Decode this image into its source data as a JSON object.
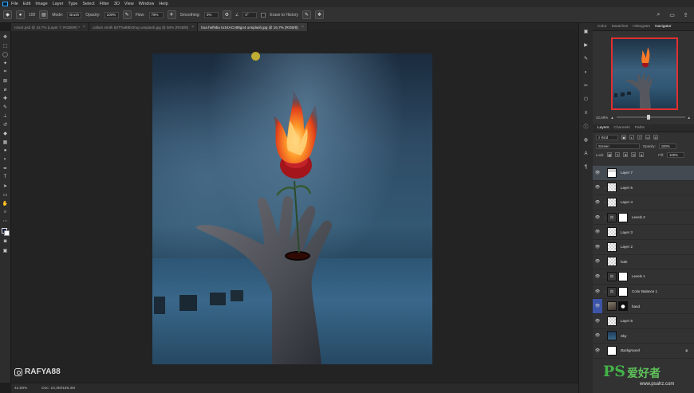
{
  "menu": [
    "File",
    "Edit",
    "Image",
    "Layer",
    "Type",
    "Select",
    "Filter",
    "3D",
    "View",
    "Window",
    "Help"
  ],
  "options": {
    "brush_size": "100",
    "mode_label": "Mode:",
    "mode_value": "Brush",
    "opacity_label": "Opacity:",
    "opacity_value": "100%",
    "flow_label": "Flow:",
    "flow_value": "79%",
    "smoothing_label": "Smoothing:",
    "smoothing_value": "0%",
    "angle_value": "0°",
    "erase_to_history": "Erase to History"
  },
  "tabs": [
    {
      "label": "rose2.psd @ 42,7% (Layer 7, RGB/8#) *",
      "active": false
    },
    {
      "label": "callum smith 8dTTwB8bOmg unsplash.jpg @ 50% (RGB/8)",
      "active": false
    },
    {
      "label": "boa hefNbu to1KACnt8tgo4 unsplash.jpg @ 16,7% (RGB/8)",
      "active": true
    }
  ],
  "status": {
    "zoom": "42,69%",
    "doc": "Doc: 10,3M/188,3M"
  },
  "watermark_handle": "RAFYA88",
  "panels": {
    "top_tabs": [
      "Color",
      "Swatches",
      "Histogram",
      "Navigator"
    ],
    "top_active": "Navigator",
    "nav_zoom": "42,69%",
    "layer_tabs": [
      "Layers",
      "Channels",
      "Paths"
    ],
    "layer_active": "Layers",
    "kind_label": "Kind",
    "blend_mode": "Screen",
    "opacity_label": "Opacity:",
    "opacity_value": "100%",
    "lock_label": "Lock:",
    "fill_label": "Fill:",
    "fill_value": "100%"
  },
  "layers": [
    {
      "name": "Layer 7",
      "thumb": "layer7",
      "active": true
    },
    {
      "name": "Layer 5",
      "thumb": "checker",
      "clipped": true
    },
    {
      "name": "Layer 4",
      "thumb": "checker",
      "clipped": true
    },
    {
      "name": "Levels 2",
      "thumb": "adj",
      "clipped": true,
      "mask": "mask"
    },
    {
      "name": "Layer 3",
      "thumb": "checker"
    },
    {
      "name": "Layer 2",
      "thumb": "checker"
    },
    {
      "name": "hole",
      "thumb": "checker"
    },
    {
      "name": "Levels 1",
      "thumb": "adj",
      "clipped": true,
      "mask": "mask"
    },
    {
      "name": "Color Balance 1",
      "thumb": "adj",
      "clipped": true,
      "mask": "mask"
    },
    {
      "name": "hand",
      "thumb": "photo-hand",
      "mask": "mask-dark",
      "selected_strip": true
    },
    {
      "name": "Layer 6",
      "thumb": "checker"
    },
    {
      "name": "Sky",
      "thumb": "photo-sky"
    },
    {
      "name": "Background",
      "thumb": "white",
      "italic": true,
      "locked": true
    }
  ],
  "site_watermark": {
    "ps": "PS",
    "cn": "爱好者",
    "url": "www.psahz.com"
  }
}
